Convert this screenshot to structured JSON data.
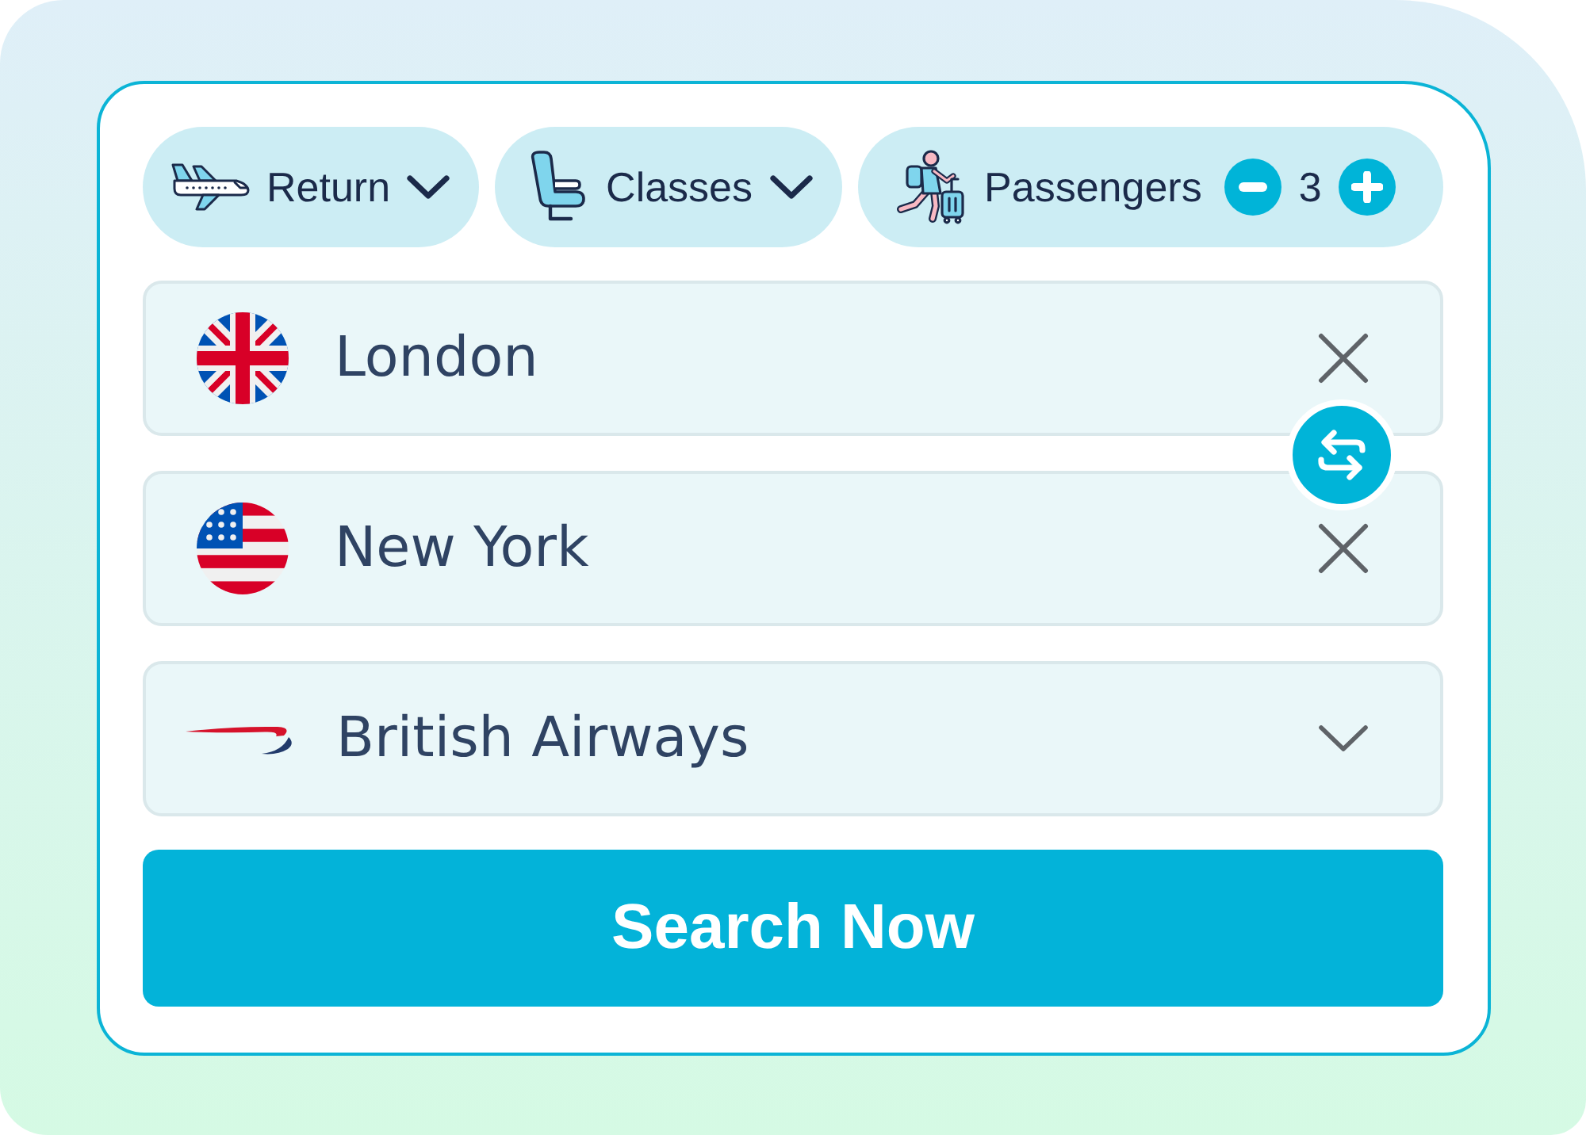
{
  "trip_options": [
    {
      "kind": "trip",
      "label": "Return"
    },
    {
      "kind": "cabin",
      "label": "Classes"
    },
    {
      "kind": "passengers",
      "label": "Passengers",
      "count": "3"
    }
  ],
  "route": [
    {
      "value": "London"
    },
    {
      "value": "New York"
    }
  ],
  "airline": {
    "value": "British Airways"
  },
  "search_button": "Search Now"
}
